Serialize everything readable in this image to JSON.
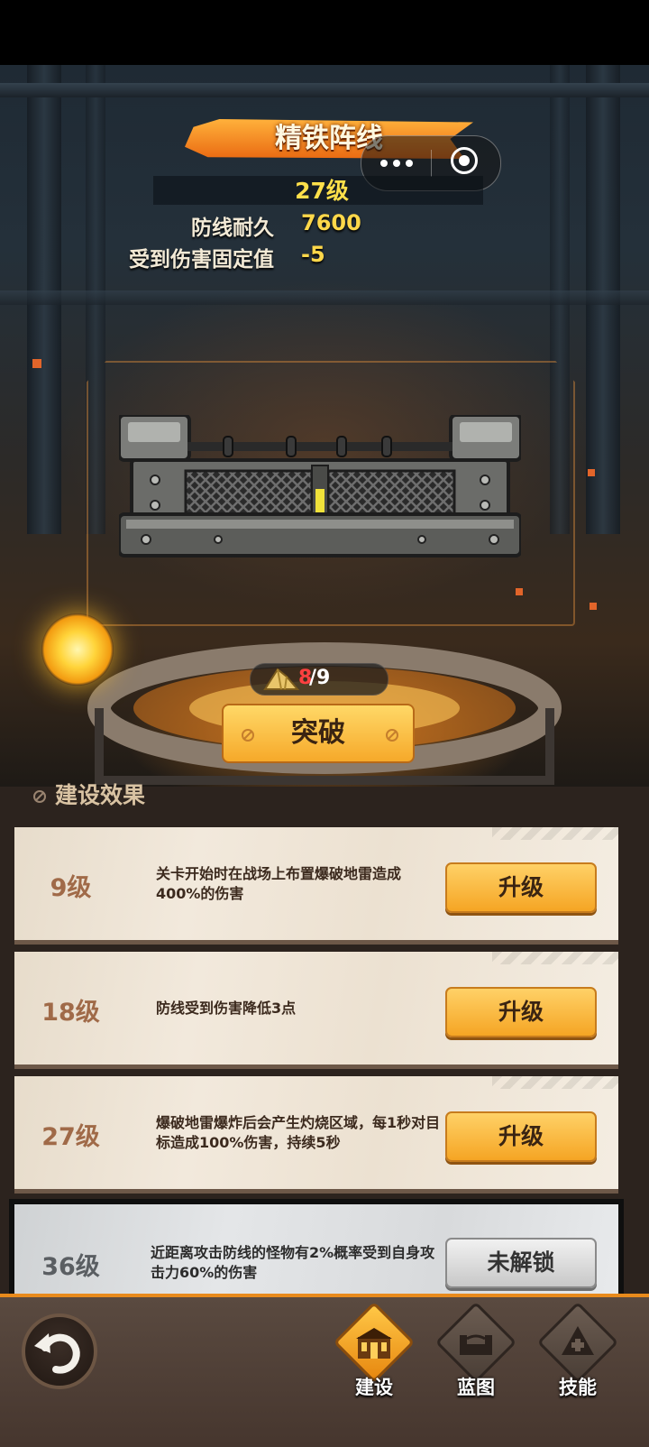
{
  "building": {
    "title": "精铁阵线",
    "level": "27级",
    "stats": [
      {
        "label": "防线耐久",
        "value": "7600"
      },
      {
        "label": "受到伤害固定值",
        "value": "-5"
      }
    ]
  },
  "breakthrough": {
    "current": "8",
    "max": "/9",
    "button_label": "突破"
  },
  "effects": {
    "section_title": "建设效果",
    "cards": [
      {
        "level": "9级",
        "description": "关卡开始时在战场上布置爆破地雷造成400%的伤害",
        "button": "升级",
        "locked": false
      },
      {
        "level": "18级",
        "description": "防线受到伤害降低3点",
        "button": "升级",
        "locked": false
      },
      {
        "level": "27级",
        "description": "爆破地雷爆炸后会产生灼烧区域，每1秒对目标造成100%伤害，持续5秒",
        "button": "升级",
        "locked": false
      },
      {
        "level": "36级",
        "description": "近距离攻击防线的怪物有2%概率受到自身攻击力60%的伤害",
        "button": "未解锁",
        "locked": true
      }
    ]
  },
  "bottom_nav": {
    "items": [
      {
        "label": "建设",
        "icon": "building-icon",
        "active": true
      },
      {
        "label": "蓝图",
        "icon": "blueprint-icon",
        "active": false
      },
      {
        "label": "技能",
        "icon": "skill-icon",
        "active": false
      }
    ]
  },
  "colors": {
    "accent": "#f5a524",
    "level_text": "#ffe04a",
    "counter_current": "#ff4040",
    "nav_border": "#e88a1c"
  }
}
